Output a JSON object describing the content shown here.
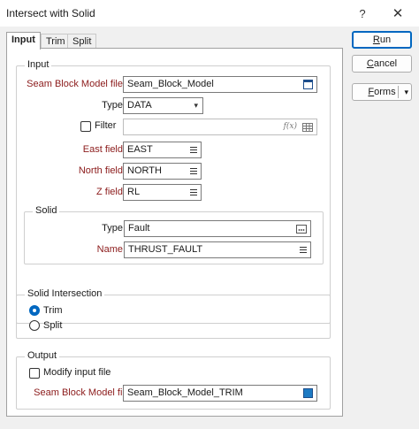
{
  "window": {
    "title": "Intersect with Solid",
    "help": "?",
    "close": "✕"
  },
  "tabs": [
    {
      "label": "Input",
      "active": true
    },
    {
      "label": "Trim",
      "active": false
    },
    {
      "label": "Split",
      "active": false
    }
  ],
  "buttons": {
    "run": {
      "underline": "R",
      "rest": "un"
    },
    "cancel": {
      "underline": "C",
      "rest": "ancel"
    },
    "forms": {
      "underline": "F",
      "rest": "orms",
      "arrow": "▾"
    }
  },
  "input": {
    "group_label": "Input",
    "seam_block_model_label": "Seam Block Model file",
    "seam_block_model_value": "Seam_Block_Model",
    "type_label": "Type",
    "type_value": "DATA",
    "filter_label": "Filter",
    "filter_checked": false,
    "filter_value": "",
    "fx_icon": "f(x)",
    "east_label": "East field",
    "east_value": "EAST",
    "north_label": "North field",
    "north_value": "NORTH",
    "z_label": "Z field",
    "z_value": "RL"
  },
  "solid": {
    "group_label": "Solid",
    "type_label": "Type",
    "type_value": "Fault",
    "name_label": "Name",
    "name_value": "THRUST_FAULT"
  },
  "solid_intersection": {
    "group_label": "Solid Intersection",
    "options": [
      {
        "label": "Trim",
        "selected": true
      },
      {
        "label": "Split",
        "selected": false
      }
    ]
  },
  "output": {
    "group_label": "Output",
    "modify_label": "Modify input file",
    "modify_checked": false,
    "file_label": "Seam Block Model file",
    "file_value": "Seam_Block_Model_TRIM"
  },
  "colors": {
    "accent": "#0067c0",
    "required_label": "#8b1a1a",
    "file_icon_fill": "#1e7bc4"
  }
}
